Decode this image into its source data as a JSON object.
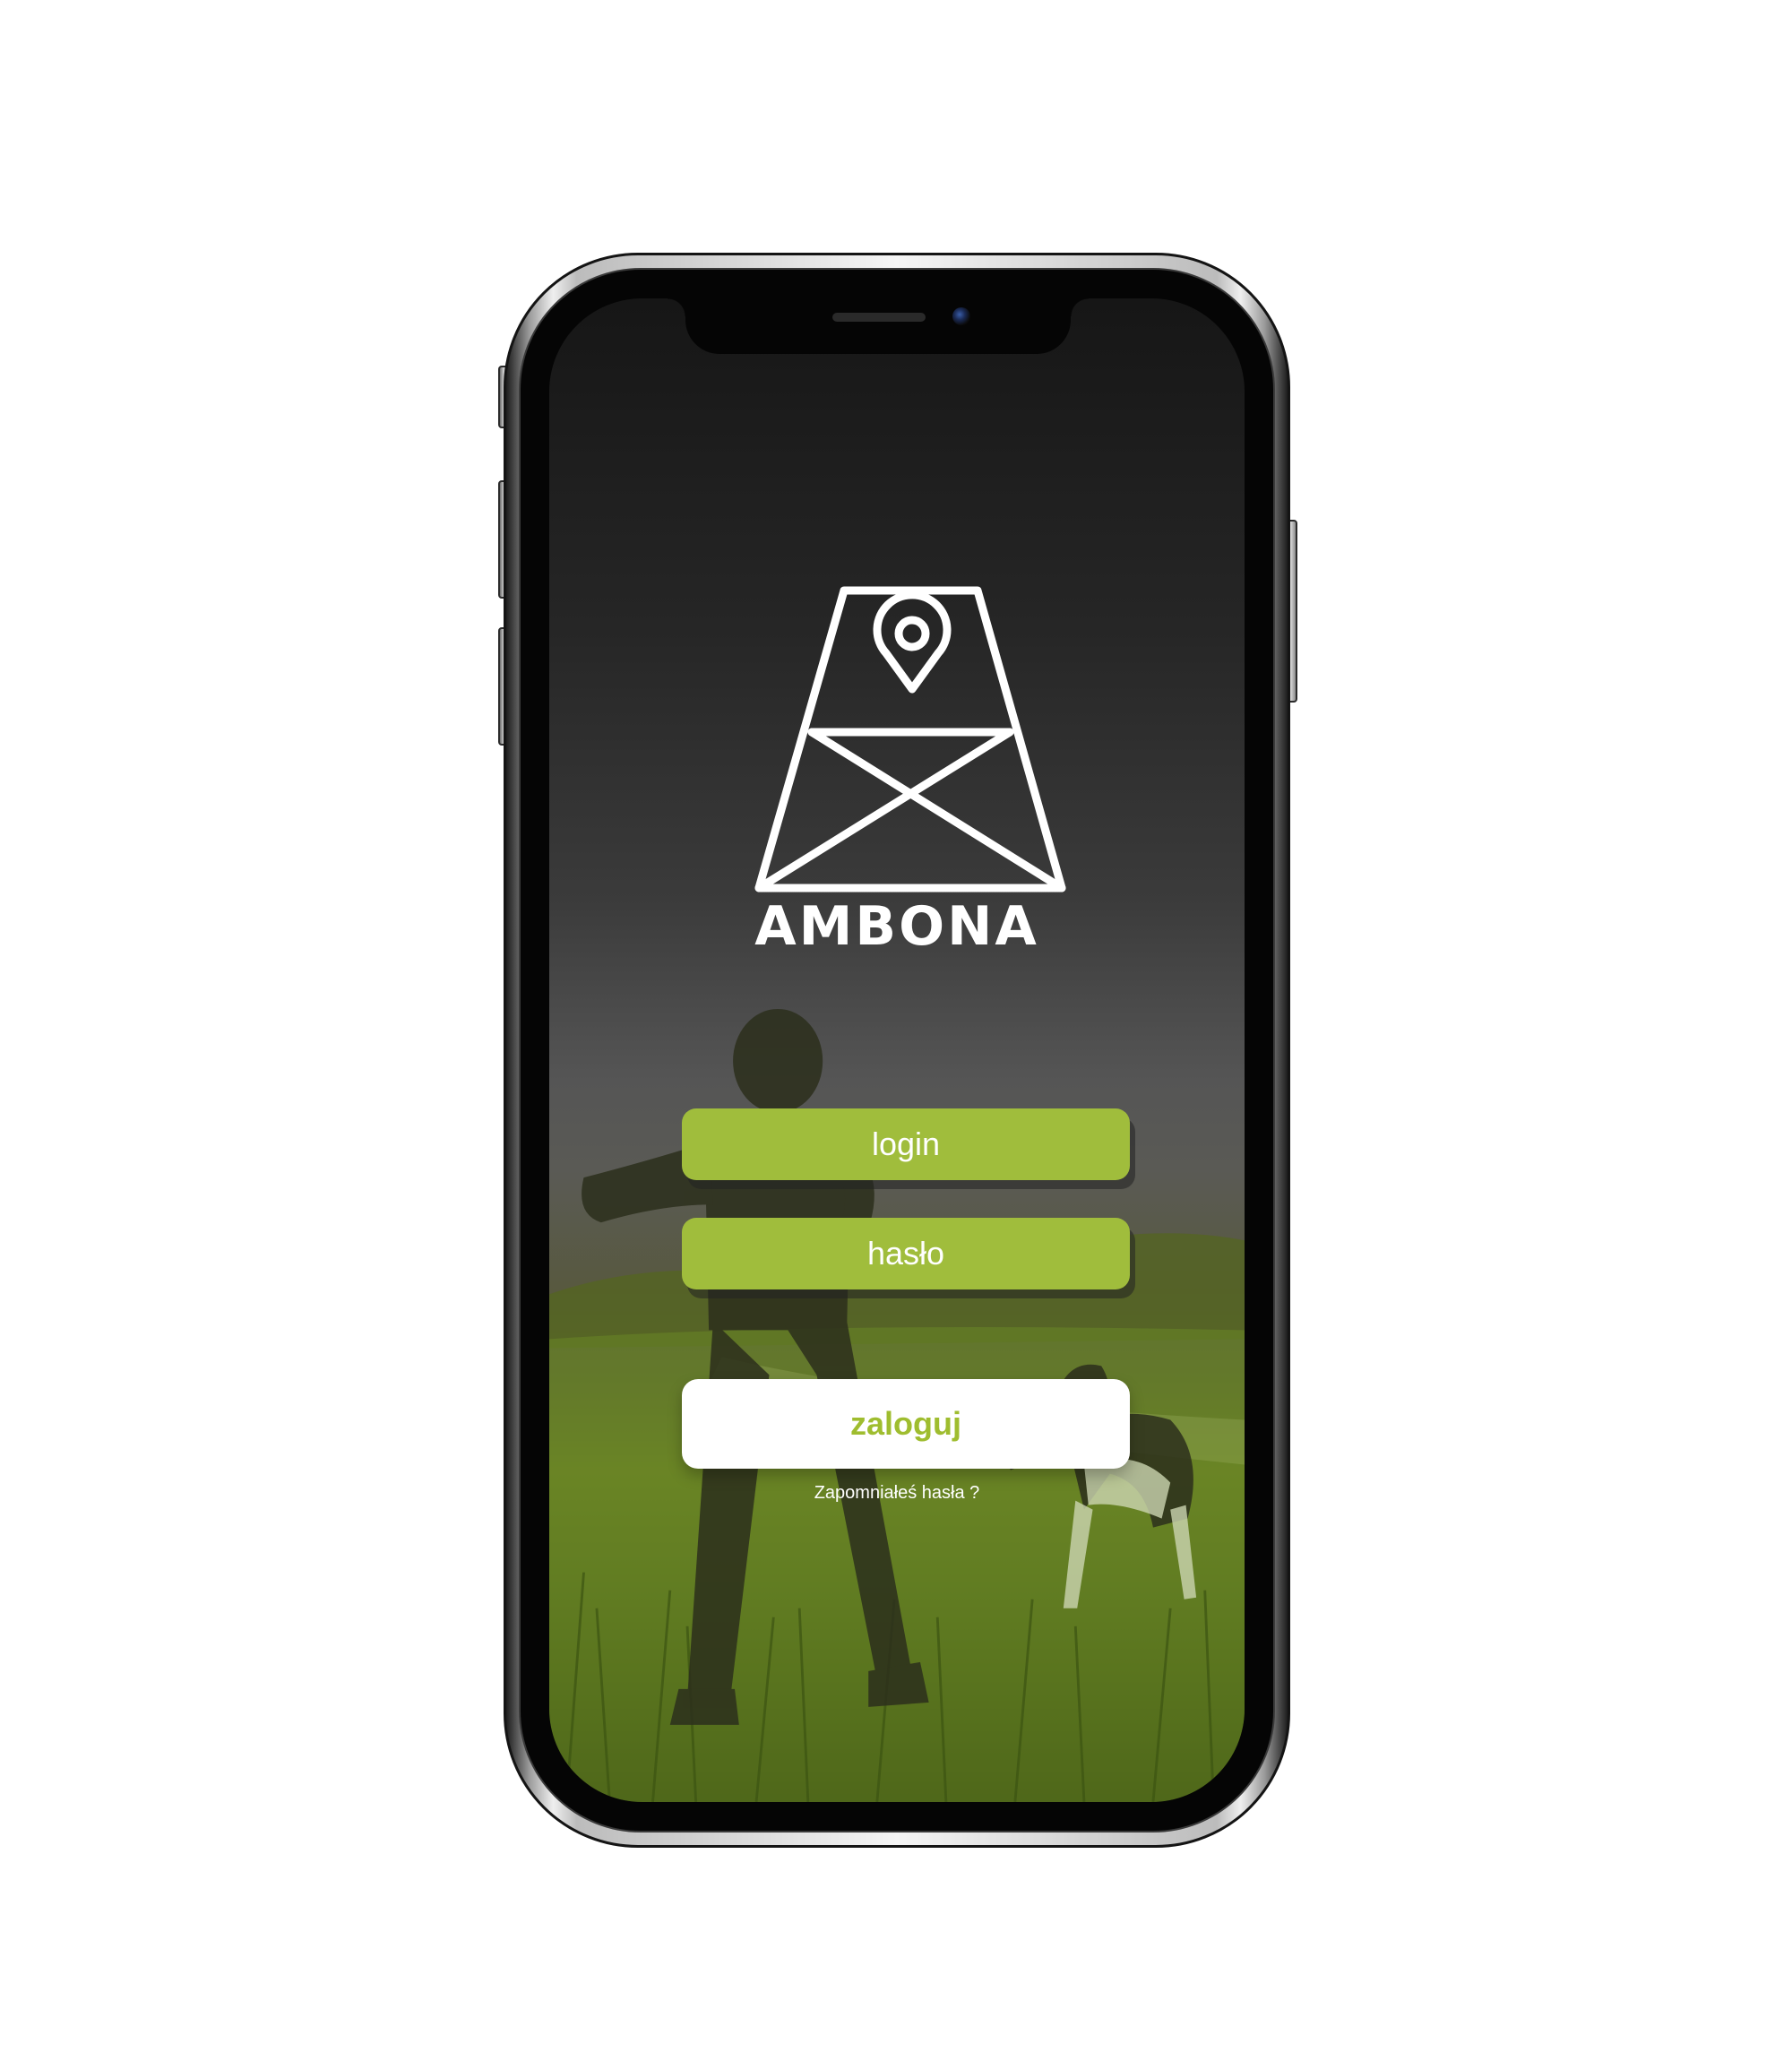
{
  "app": {
    "brand_name": "AMBONA",
    "logo_icon": "hunting-tower-with-location-pin"
  },
  "form": {
    "login_label": "login",
    "password_label": "hasło",
    "submit_label": "zaloguj",
    "forgot_password_label": "Zapomniałeś hasła ?"
  },
  "colors": {
    "accent_green": "#a0bd3c",
    "submit_text": "#9fbd2f",
    "text_light": "#ffffff"
  }
}
